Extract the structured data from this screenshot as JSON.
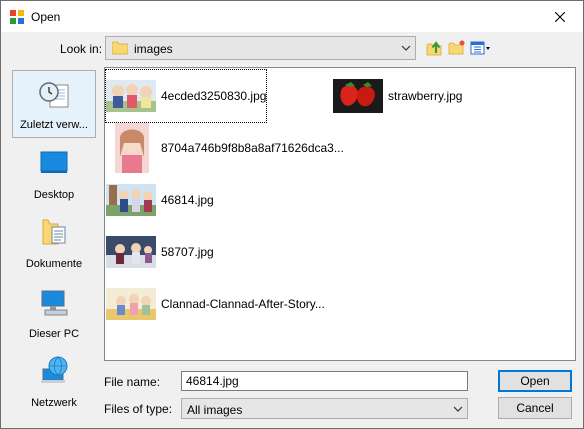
{
  "title": "Open",
  "look_in": {
    "label": "Look in:",
    "value": "images"
  },
  "places": [
    {
      "label": "Zuletzt verw...",
      "icon": "recent-places-icon"
    },
    {
      "label": "Desktop",
      "icon": "desktop-icon"
    },
    {
      "label": "Dokumente",
      "icon": "documents-icon"
    },
    {
      "label": "Dieser PC",
      "icon": "computer-icon"
    },
    {
      "label": "Netzwerk",
      "icon": "network-icon"
    }
  ],
  "files": [
    {
      "name": "4ecded3250830.jpg"
    },
    {
      "name": "strawberry.jpg"
    },
    {
      "name": "8704a746b9f8b8a8af71626dca3..."
    },
    {
      "name": "46814.jpg"
    },
    {
      "name": "58707.jpg"
    },
    {
      "name": "Clannad-Clannad-After-Story..."
    }
  ],
  "file_name": {
    "label": "File name:",
    "value": "46814.jpg"
  },
  "file_type": {
    "label": "Files of type:",
    "value": "All images"
  },
  "buttons": {
    "open": "Open",
    "cancel": "Cancel"
  }
}
